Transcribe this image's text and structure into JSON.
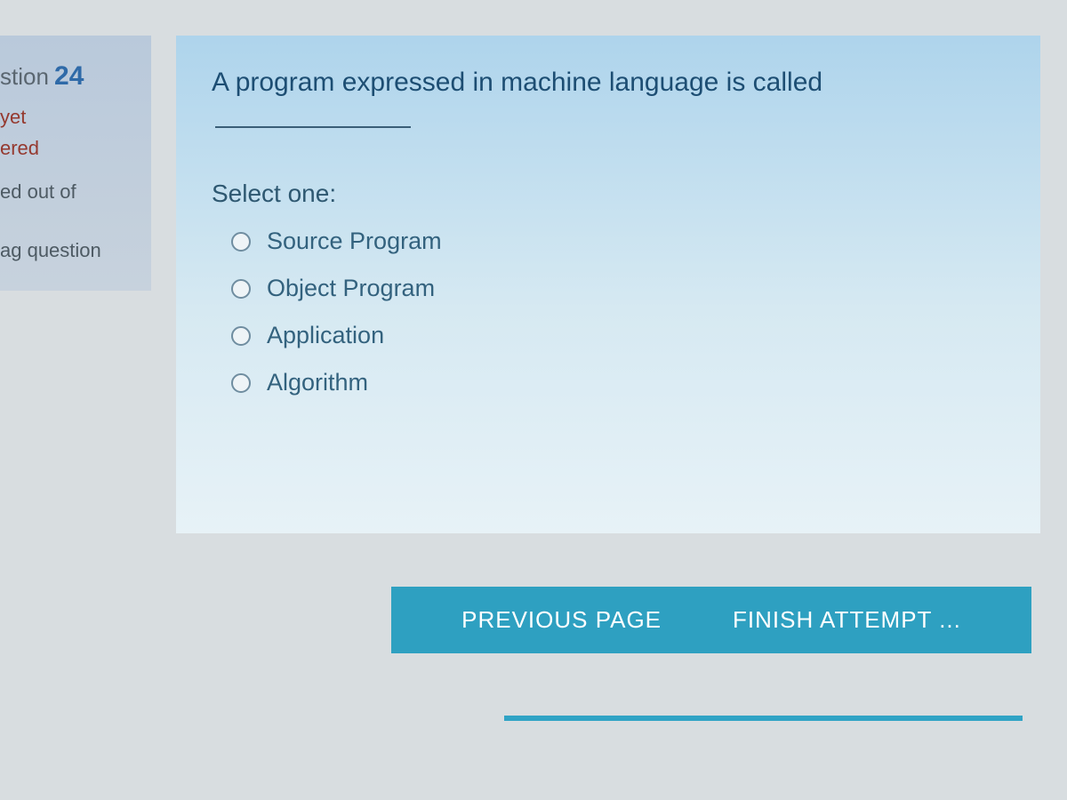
{
  "sidebar": {
    "question_label_prefix": "stion",
    "question_number": "24",
    "status_line1": "yet",
    "status_line2": "ered",
    "marks_line": "ed out of",
    "flag_line": "ag question"
  },
  "question": {
    "text": "A program expressed in machine language is called",
    "select_prompt": "Select one:",
    "options": [
      "Source Program",
      "Object Program",
      "Application",
      "Algorithm"
    ]
  },
  "nav": {
    "prev": "PREVIOUS PAGE",
    "finish": "FINISH ATTEMPT ..."
  }
}
